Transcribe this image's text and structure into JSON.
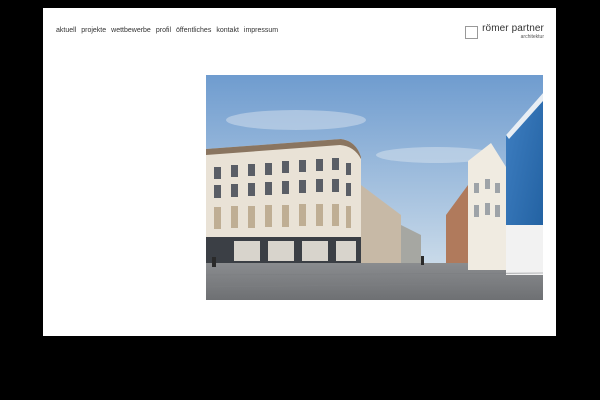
{
  "nav": {
    "items": [
      {
        "label": "aktuell"
      },
      {
        "label": "projekte"
      },
      {
        "label": "wettbewerbe"
      },
      {
        "label": "profil"
      },
      {
        "label": "öffentliches"
      },
      {
        "label": "kontakt"
      },
      {
        "label": "impressum"
      }
    ]
  },
  "brand": {
    "name": "römer partner",
    "subtitle": "architektur"
  },
  "colors": {
    "background": "#000000",
    "page": "#ffffff",
    "text": "#333333"
  }
}
